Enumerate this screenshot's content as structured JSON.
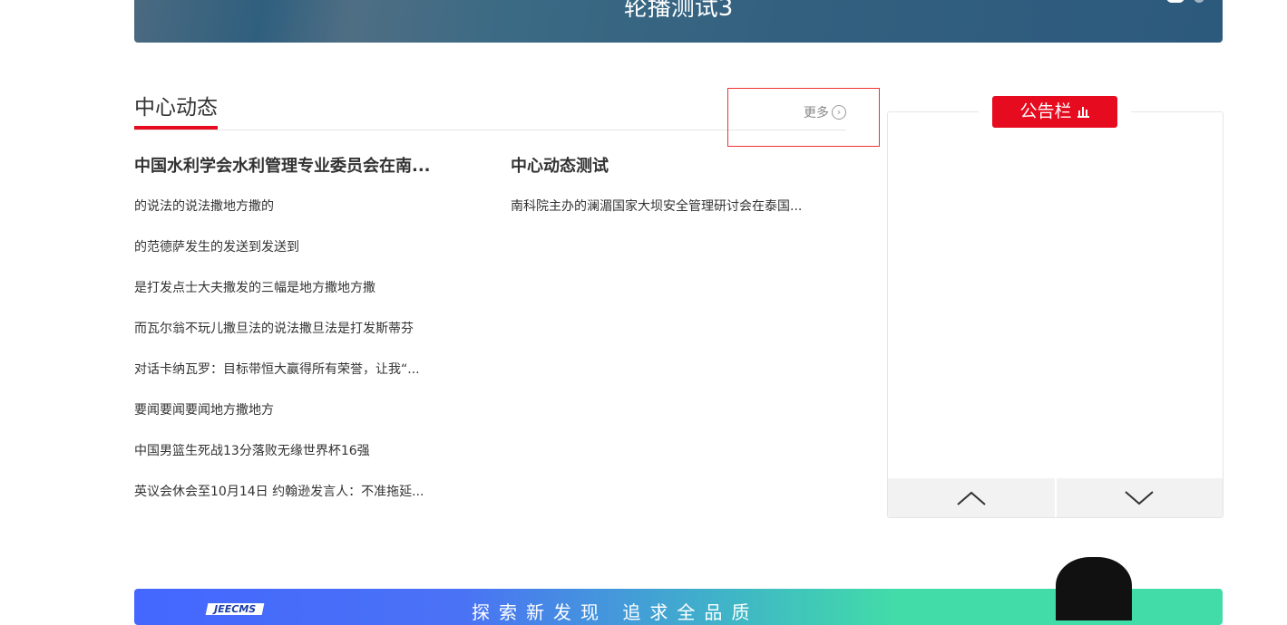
{
  "carousel": {
    "title": "轮播测试3",
    "slides": 2,
    "active": 1
  },
  "center_news": {
    "title": "中心动态",
    "more_label": "更多",
    "col1": {
      "headline": "中国水利学会水利管理专业委员会在南...",
      "items": [
        "的说法的说法撒地方撒的",
        "的范德萨发生的发送到发送到",
        "是打发点士大夫撒发的三幅是地方撒地方撒",
        "而瓦尔翁不玩儿撒旦法的说法撒旦法是打发斯蒂芬",
        "对话卡纳瓦罗：目标带恒大赢得所有荣誉，让我“...",
        "要闻要闻要闻地方撒地方",
        "中国男篮生死战13分落败无缘世界杯16强",
        "英议会休会至10月14日 约翰逊发言人：不准拖延..."
      ]
    },
    "col2": {
      "headline": "中心动态测试",
      "items": [
        "南科院主办的澜湄国家大坝安全管理研讨会在泰国..."
      ]
    }
  },
  "notice": {
    "title": "公告栏"
  },
  "banner": {
    "brand": "JEECMS",
    "slogan": "探索新发现 追求全品质"
  },
  "colors": {
    "accent": "#e60b1e"
  }
}
